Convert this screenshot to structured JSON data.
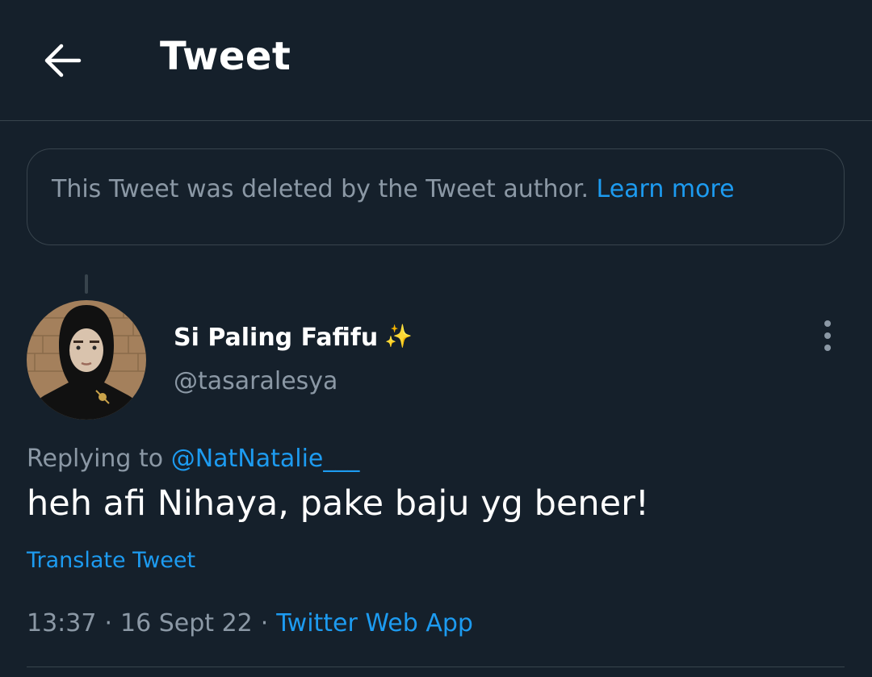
{
  "header": {
    "title": "Tweet",
    "back_icon": "arrow-left-icon"
  },
  "notice": {
    "text": "This Tweet was deleted by the Tweet author.",
    "link": "Learn more"
  },
  "author": {
    "display_name": "Si Paling Fafifu",
    "emoji": "✨",
    "handle": "@tasaralesya",
    "avatar_icon": "user-avatar"
  },
  "reply": {
    "prefix": "Replying to",
    "mention": "@NatNatalie___"
  },
  "tweet": {
    "text": "heh afi Nihaya, pake baju yg bener!",
    "translate": "Translate Tweet"
  },
  "meta": {
    "time": "13:37",
    "separator": "·",
    "date": "16 Sept 22",
    "source": "Twitter Web App"
  },
  "colors": {
    "background": "#15202b",
    "accent": "#1d9bf0",
    "muted": "#8b98a5",
    "border": "#38444d"
  }
}
